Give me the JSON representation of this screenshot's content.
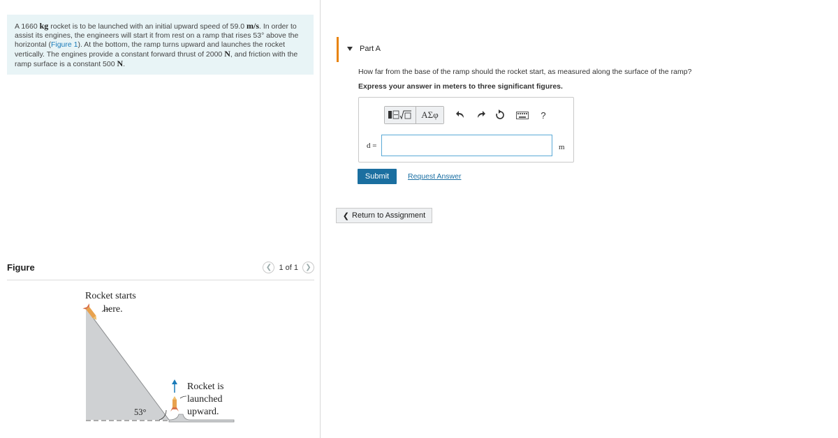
{
  "problem": {
    "line1_a": "A 1660 ",
    "line1_m1": "kg",
    "line1_b": " rocket is to be launched with an initial upward speed of 59.0 ",
    "line1_m2": "m/s",
    "line1_c": ". In order to",
    "line2": "assist its engines, the engineers will start it from rest on a ramp that rises 53° above the",
    "line3_a": "horizontal (",
    "line3_link": "Figure 1",
    "line3_b": "). At the bottom, the ramp turns upward and launches the rocket",
    "line4_a": "vertically. The engines provide a constant forward thrust of 2000 ",
    "line4_m": "N",
    "line4_b": ", and friction with the",
    "line5_a": "ramp surface is a constant 500 ",
    "line5_m": "N",
    "line5_b": "."
  },
  "figure": {
    "title": "Figure",
    "counter": "1 of 1",
    "labels": {
      "start_1": "Rocket starts",
      "start_2": "here.",
      "launch_1": "Rocket is",
      "launch_2": "launched",
      "launch_3": "upward.",
      "angle": "53°"
    }
  },
  "part": {
    "label": "Part A",
    "question": "How far from the base of the ramp should the rocket start, as measured along the surface of the ramp?",
    "instruction": "Express your answer in meters to three significant figures.",
    "variable": "d =",
    "unit": "m",
    "input_value": "",
    "toolbar": {
      "templates_icon": "radical-template-icon",
      "greek": "ΑΣφ",
      "help": "?"
    },
    "submit": "Submit",
    "request": "Request Answer"
  },
  "nav": {
    "return": "Return to Assignment"
  },
  "colors": {
    "accent": "#e8830c",
    "primary": "#1b6fa0",
    "link": "#1a7bb9",
    "problem_bg": "#e8f4f6"
  }
}
